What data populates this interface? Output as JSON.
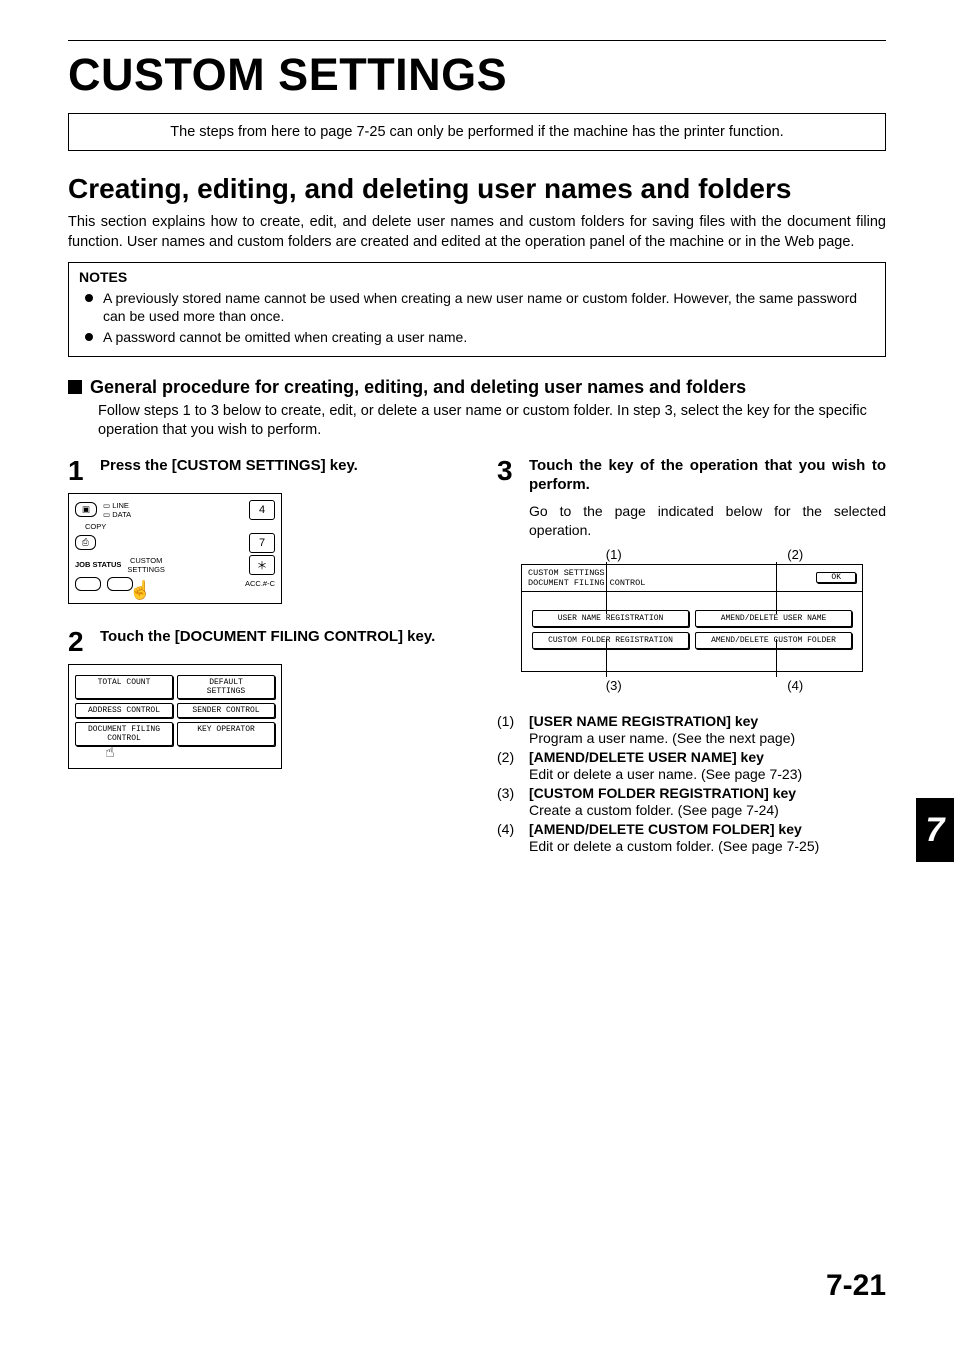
{
  "main_title": "CUSTOM SETTINGS",
  "top_note": "The steps from here to page 7-25 can only be performed if the machine has the printer function.",
  "section_title": "Creating, editing, and deleting user names and folders",
  "section_intro": "This section explains how to create, edit, and delete user names and custom folders for saving files with the document filing function. User names and custom folders are created and edited at the operation panel of the machine or in the Web page.",
  "notes": {
    "heading": "NOTES",
    "items": [
      "A previously stored name cannot be used when creating a new user name or custom folder. However, the same password can be used more than once.",
      "A password cannot be omitted when creating a user name."
    ]
  },
  "subhead": "General procedure for creating, editing, and deleting user names and folders",
  "subhead_desc": "Follow steps 1 to 3 below to create, edit, or delete a user name or custom folder. In step 3, select the key for the specific operation that you wish to perform.",
  "steps": {
    "s1": {
      "num": "1",
      "title": "Press the [CUSTOM SETTINGS] key."
    },
    "s2": {
      "num": "2",
      "title": "Touch the [DOCUMENT FILING CONTROL] key."
    },
    "s3": {
      "num": "3",
      "title": "Touch the key of the operation that you wish to perform.",
      "sub": "Go to the page indicated below for the selected operation."
    }
  },
  "fig1": {
    "line": "LINE",
    "data": "DATA",
    "copy": "COPY",
    "job_status": "JOB STATUS",
    "custom_settings": "CUSTOM\nSETTINGS",
    "k4": "4",
    "k7": "7",
    "kstar": "＊",
    "acc": "ACC.#-C"
  },
  "fig2": {
    "total_count": "TOTAL COUNT",
    "default_settings": "DEFAULT\nSETTINGS",
    "address_control": "ADDRESS CONTROL",
    "sender_control": "SENDER CONTROL",
    "doc_filing": "DOCUMENT FILING\nCONTROL",
    "key_operator": "KEY OPERATOR"
  },
  "fig3": {
    "top_labels": [
      "(1)",
      "(2)"
    ],
    "bot_labels": [
      "(3)",
      "(4)"
    ],
    "custom_settings": "CUSTOM SETTINGS",
    "doc_filing_control": "DOCUMENT FILING CONTROL",
    "ok": "OK",
    "user_name_reg": "USER NAME REGISTRATION",
    "amend_user": "AMEND/DELETE USER NAME",
    "custom_folder_reg": "CUSTOM FOLDER REGISTRATION",
    "amend_folder": "AMEND/DELETE CUSTOM FOLDER"
  },
  "ops": [
    {
      "n": "(1)",
      "key": "[USER NAME REGISTRATION] key",
      "desc": "Program a user name. (See the next page)"
    },
    {
      "n": "(2)",
      "key": "[AMEND/DELETE USER NAME] key",
      "desc": "Edit or delete a user name. (See page 7-23)"
    },
    {
      "n": "(3)",
      "key": "[CUSTOM FOLDER REGISTRATION] key",
      "desc": "Create a custom folder. (See page 7-24)"
    },
    {
      "n": "(4)",
      "key": "[AMEND/DELETE CUSTOM FOLDER] key",
      "desc": "Edit or delete a custom folder. (See page 7-25)"
    }
  ],
  "chapter_tab": "7",
  "page_number": "7-21"
}
